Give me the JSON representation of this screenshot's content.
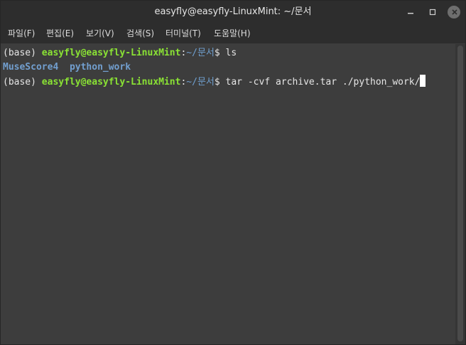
{
  "window": {
    "title": "easyfly@easyfly-LinuxMint: ~/문서",
    "controls": [
      "minimize-icon",
      "maximize-icon",
      "close-icon"
    ]
  },
  "menu": [
    {
      "label": "파일(F)"
    },
    {
      "label": "편집(E)"
    },
    {
      "label": "보기(V)"
    },
    {
      "label": "검색(S)"
    },
    {
      "label": "터미널(T)"
    },
    {
      "label": "도움말(H)"
    }
  ],
  "terminal": {
    "line1": {
      "env": "(base) ",
      "prompt": "easyfly@easyfly-LinuxMint",
      "colon": ":",
      "path": "~/문서",
      "dollar": "$ ",
      "command": "ls"
    },
    "line2": {
      "items": [
        "MuseScore4",
        "python_work"
      ],
      "sep": "  "
    },
    "line3": {
      "env": "(base) ",
      "prompt": "easyfly@easyfly-LinuxMint",
      "colon": ":",
      "path": "~/문서",
      "dollar": "$ ",
      "command": "tar -cvf archive.tar ./python_work/"
    }
  },
  "colors": {
    "prompt_user": "#8ae234",
    "prompt_path": "#6f9fcf",
    "directory": "#729fcf",
    "background": "#3d3d3d",
    "text": "#e6e6e6"
  }
}
